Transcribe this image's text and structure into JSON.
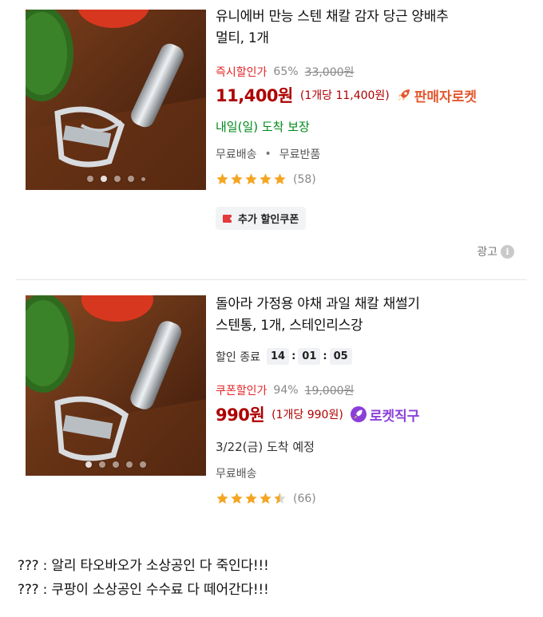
{
  "products": [
    {
      "title_line1": "유니에버 만능 스텐 채칼 감자 당근 양배추",
      "title_line2": "멀티, 1개",
      "discount_label": "즉시할인가",
      "discount_pct": "65%",
      "original_price": "33,000원",
      "price": "11,400원",
      "unit_price": "(1개당 11,400원)",
      "badge": "판매자로켓",
      "badge_icon": "rocket-icon",
      "delivery": "내일(일) 도착 보장",
      "shipping": [
        "무료배송",
        "무료반품"
      ],
      "rating": 5,
      "reviews": "(58)",
      "coupon": "추가 할인쿠폰",
      "image_dots": 5,
      "image_active_index": 1
    },
    {
      "title_line1": "돌아라 가정용 야채 과일 채칼 채썰기",
      "title_line2": "스텐통, 1개, 스테인리스강",
      "timer_label": "할인 종료",
      "timer": [
        "14",
        "01",
        "05"
      ],
      "discount_label": "쿠폰할인가",
      "discount_pct": "94%",
      "original_price": "19,000원",
      "price": "990원",
      "unit_price": "(1개당 990원)",
      "badge": "로켓직구",
      "badge_icon": "rocket-global-icon",
      "delivery": "3/22(금) 도착 예정",
      "shipping": [
        "무료배송"
      ],
      "rating": 4.5,
      "reviews": "(66)",
      "image_dots": 5,
      "image_active_index": 0
    }
  ],
  "ad_label": "광고",
  "comments": [
    "??? : 알리 타오바오가 소상공인 다 죽인다!!!",
    "??? : 쿠팡이 소상공인 수수료 다 떼어간다!!!"
  ],
  "colors": {
    "price": "#ae0000",
    "discount": "#e52528",
    "delivery_guaranteed": "#00891a",
    "star": "#f4a623",
    "seller_rocket": "#e4572e",
    "rocket_global": "#8b3fd9"
  }
}
